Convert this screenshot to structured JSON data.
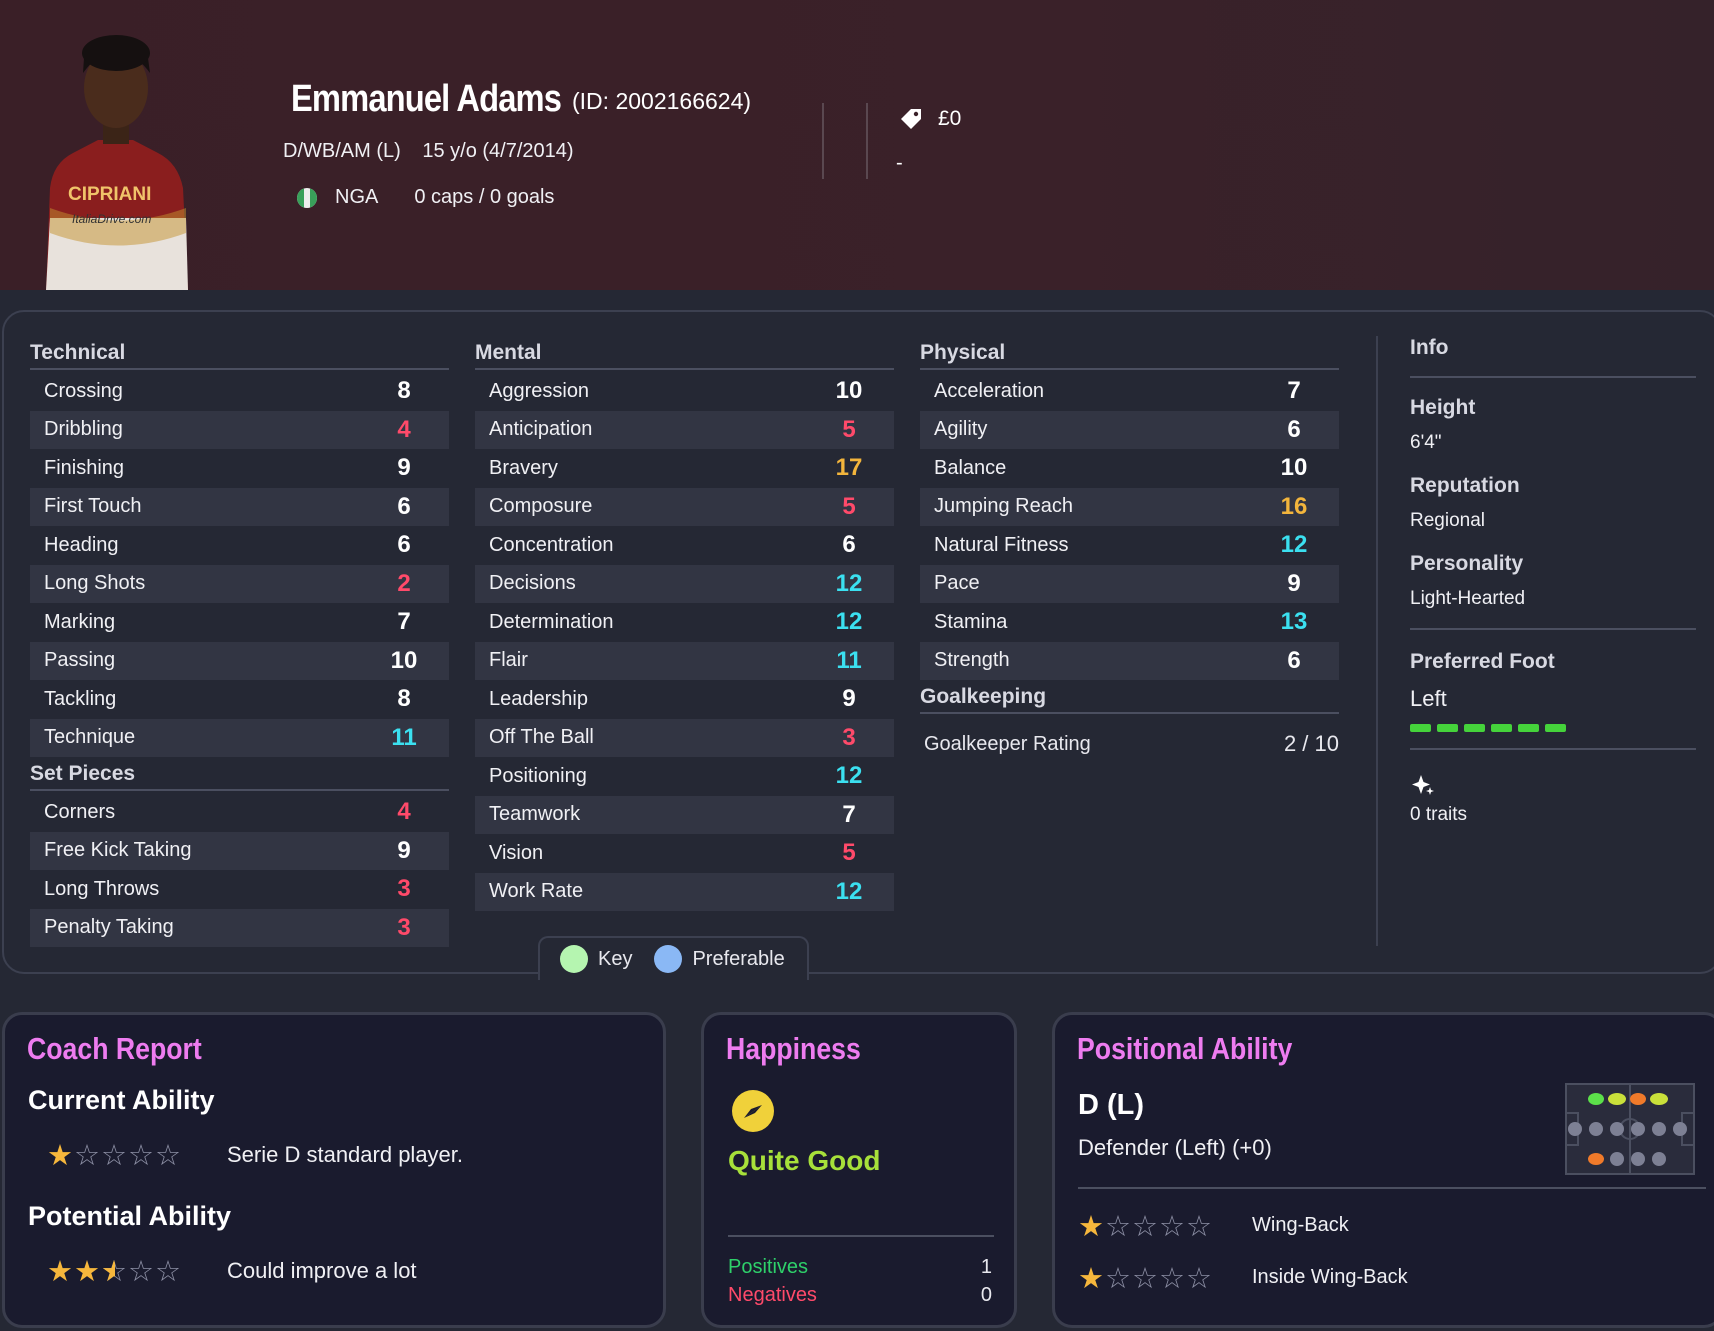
{
  "player": {
    "name": "Emmanuel Adams",
    "id_text": "(ID: 2002166624)",
    "positions": "D/WB/AM (L)",
    "age_dob": "15 y/o (4/7/2014)",
    "nation": "NGA",
    "caps": "0 caps / 0 goals",
    "value": "£0",
    "contract": "-"
  },
  "technical": {
    "title": "Technical",
    "rows": [
      {
        "label": "Crossing",
        "value": "8",
        "tone": "white"
      },
      {
        "label": "Dribbling",
        "value": "4",
        "tone": "red"
      },
      {
        "label": "Finishing",
        "value": "9",
        "tone": "white"
      },
      {
        "label": "First Touch",
        "value": "6",
        "tone": "white"
      },
      {
        "label": "Heading",
        "value": "6",
        "tone": "white"
      },
      {
        "label": "Long Shots",
        "value": "2",
        "tone": "red"
      },
      {
        "label": "Marking",
        "value": "7",
        "tone": "white"
      },
      {
        "label": "Passing",
        "value": "10",
        "tone": "white"
      },
      {
        "label": "Tackling",
        "value": "8",
        "tone": "white"
      },
      {
        "label": "Technique",
        "value": "11",
        "tone": "cyan"
      }
    ]
  },
  "set_pieces": {
    "title": "Set Pieces",
    "rows": [
      {
        "label": "Corners",
        "value": "4",
        "tone": "red"
      },
      {
        "label": "Free Kick Taking",
        "value": "9",
        "tone": "white"
      },
      {
        "label": "Long Throws",
        "value": "3",
        "tone": "red"
      },
      {
        "label": "Penalty Taking",
        "value": "3",
        "tone": "red"
      }
    ]
  },
  "mental": {
    "title": "Mental",
    "rows": [
      {
        "label": "Aggression",
        "value": "10",
        "tone": "white"
      },
      {
        "label": "Anticipation",
        "value": "5",
        "tone": "red"
      },
      {
        "label": "Bravery",
        "value": "17",
        "tone": "orange"
      },
      {
        "label": "Composure",
        "value": "5",
        "tone": "red"
      },
      {
        "label": "Concentration",
        "value": "6",
        "tone": "white"
      },
      {
        "label": "Decisions",
        "value": "12",
        "tone": "cyan"
      },
      {
        "label": "Determination",
        "value": "12",
        "tone": "cyan"
      },
      {
        "label": "Flair",
        "value": "11",
        "tone": "cyan"
      },
      {
        "label": "Leadership",
        "value": "9",
        "tone": "white"
      },
      {
        "label": "Off The Ball",
        "value": "3",
        "tone": "red"
      },
      {
        "label": "Positioning",
        "value": "12",
        "tone": "cyan"
      },
      {
        "label": "Teamwork",
        "value": "7",
        "tone": "white"
      },
      {
        "label": "Vision",
        "value": "5",
        "tone": "red"
      },
      {
        "label": "Work Rate",
        "value": "12",
        "tone": "cyan"
      }
    ]
  },
  "physical": {
    "title": "Physical",
    "rows": [
      {
        "label": "Acceleration",
        "value": "7",
        "tone": "white"
      },
      {
        "label": "Agility",
        "value": "6",
        "tone": "white"
      },
      {
        "label": "Balance",
        "value": "10",
        "tone": "white"
      },
      {
        "label": "Jumping Reach",
        "value": "16",
        "tone": "orange"
      },
      {
        "label": "Natural Fitness",
        "value": "12",
        "tone": "cyan"
      },
      {
        "label": "Pace",
        "value": "9",
        "tone": "white"
      },
      {
        "label": "Stamina",
        "value": "13",
        "tone": "cyan"
      },
      {
        "label": "Strength",
        "value": "6",
        "tone": "white"
      }
    ]
  },
  "goalkeeping": {
    "title": "Goalkeeping",
    "rating_label": "Goalkeeper Rating",
    "rating_value": "2 / 10"
  },
  "info": {
    "title": "Info",
    "height_label": "Height",
    "height_value": "6'4\"",
    "reputation_label": "Reputation",
    "reputation_value": "Regional",
    "personality_label": "Personality",
    "personality_value": "Light-Hearted",
    "foot_label": "Preferred Foot",
    "foot_value": "Left",
    "foot_level": 1.0,
    "traits_text": "0 traits",
    "traits_icon": "sparkle-icon"
  },
  "key": {
    "key_label": "Key",
    "pref_label": "Preferable",
    "key_color": "#b5f5b0",
    "pref_color": "#8ab8f5"
  },
  "coach": {
    "title": "Coach Report",
    "current_title": "Current Ability",
    "current_stars": 1,
    "current_text": "Serie D standard player.",
    "potential_title": "Potential Ability",
    "potential_stars": 2.5,
    "potential_text": "Could improve a lot"
  },
  "happiness": {
    "title": "Happiness",
    "status": "Quite Good",
    "positives_label": "Positives",
    "positives_value": "1",
    "negatives_label": "Negatives",
    "negatives_value": "0"
  },
  "positional": {
    "title": "Positional Ability",
    "position": "D (L)",
    "description": "Defender (Left) (+0)",
    "roles": [
      {
        "name": "Wing-Back",
        "stars": 1
      },
      {
        "name": "Inside Wing-Back",
        "stars": 1
      }
    ]
  },
  "colors": {
    "accent_title": "#ee7cf0",
    "happy_green": "#a7e03a",
    "positive": "#2ed06a",
    "negative": "#ff4a6a",
    "star_on": "#f6b73c"
  }
}
